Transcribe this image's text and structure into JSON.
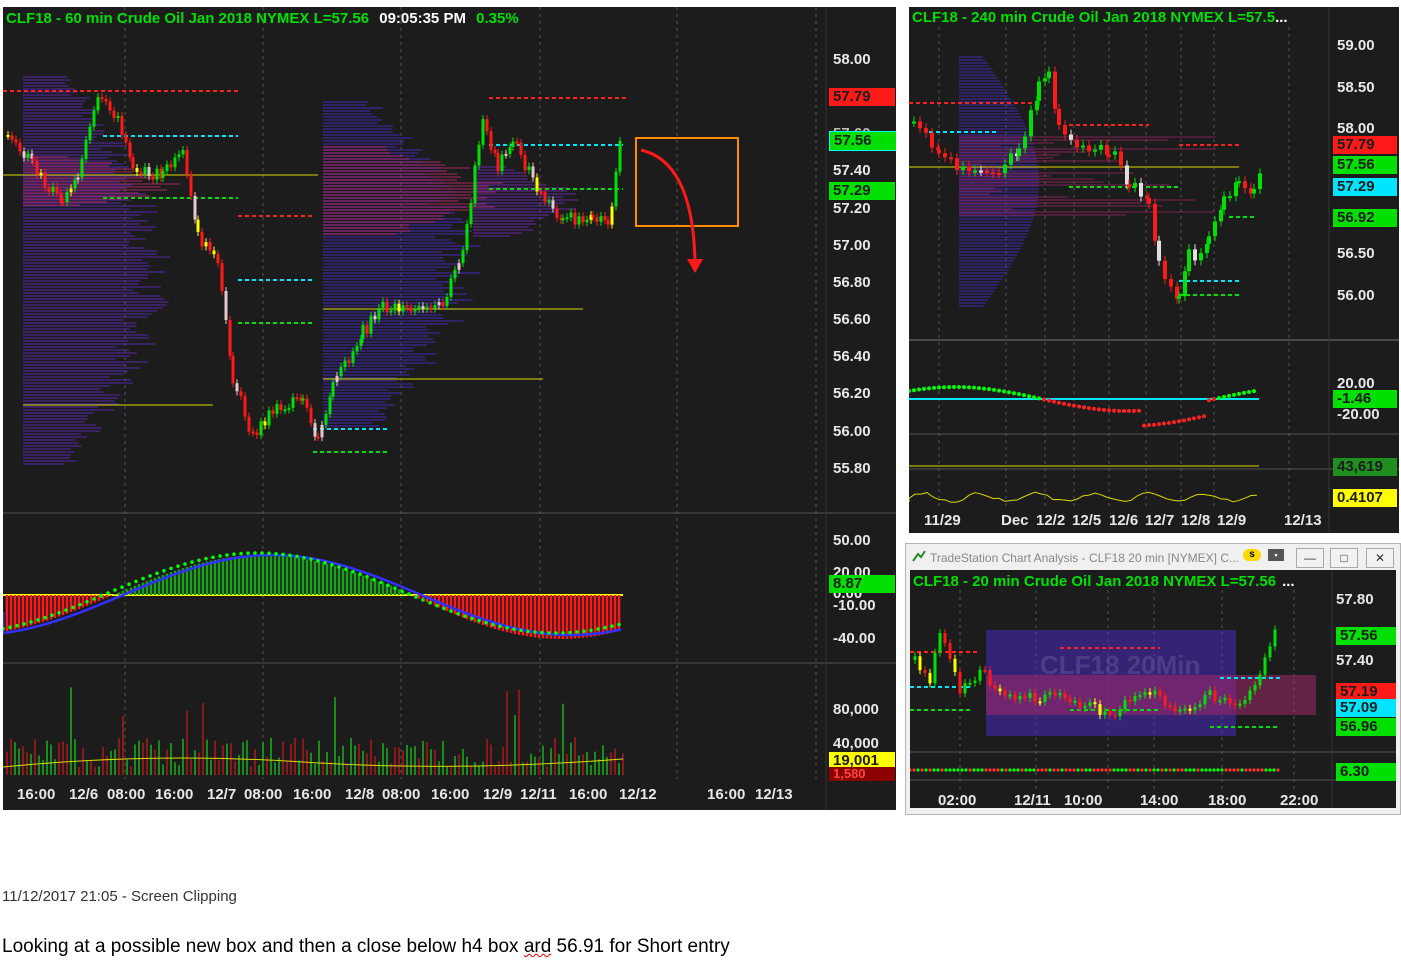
{
  "colors": {
    "bg": "#1c1c1c",
    "green": "#00e000",
    "red": "#ff1a1a",
    "cyan": "#00e5ff",
    "yellow": "#ffff00",
    "grid": "#444444",
    "orange": "#ff8c00"
  },
  "main_chart": {
    "title_parts": [
      "CLF18 - 60 min  Crude Oil Jan 2018  NYMEX  L=57.56",
      "09:05:35 PM",
      "0.35%"
    ],
    "price_axis": [
      "58.00",
      "57.60",
      "57.40",
      "57.20",
      "57.00",
      "56.80",
      "56.60",
      "56.40",
      "56.20",
      "56.00",
      "55.80"
    ],
    "price_badges": [
      {
        "text": "57.79",
        "color": "red"
      },
      {
        "text": "57.56",
        "color": "green"
      },
      {
        "text": "57.29",
        "color": "green"
      }
    ],
    "osc_axis": [
      "50.00",
      "20.00",
      "0.00",
      "-10.00",
      "-40.00"
    ],
    "osc_badge": "8.87",
    "vol_axis": [
      "80,000",
      "40,000"
    ],
    "vol_badges": [
      "19,001",
      "1,580"
    ],
    "time_axis": [
      "16:00",
      "12/6",
      "08:00",
      "16:00",
      "12/7",
      "08:00",
      "16:00",
      "12/8",
      "08:00",
      "16:00",
      "12/9",
      "12/11",
      "16:00",
      "12/12",
      "16:00",
      "12/13"
    ]
  },
  "h4_chart": {
    "title": "CLF18 - 240 min  Crude Oil Jan 2018  NYMEX  L=57.5",
    "title_more": "...",
    "price_axis": [
      "59.00",
      "58.50",
      "58.00",
      "56.50",
      "56.00"
    ],
    "price_badges": [
      {
        "text": "57.79",
        "color": "red"
      },
      {
        "text": "57.56",
        "color": "green"
      },
      {
        "text": "57.29",
        "color": "cyan"
      },
      {
        "text": "56.92",
        "color": "green"
      }
    ],
    "osc_axis": [
      "20.00",
      "-20.00"
    ],
    "osc_badge": "-1.46",
    "vol_badge": "43,619",
    "extra_badge": "0.4107",
    "time_axis": [
      "11/29",
      "Dec",
      "12/2",
      "12/5",
      "12/6",
      "12/7",
      "12/8",
      "12/9",
      "12/13"
    ]
  },
  "m20_window": {
    "window_title": "TradeStation Chart Analysis - CLF18 20 min [NYMEX] C...",
    "window_buttons": [
      "—",
      "□",
      "✕"
    ],
    "title": "CLF18 - 20 min  Crude Oil Jan 2018  NYMEX  L=57.56",
    "title_more": "...",
    "watermark": "CLF18 20Min",
    "price_axis": [
      "57.80",
      "57.40"
    ],
    "price_badges": [
      {
        "text": "57.56",
        "color": "green"
      },
      {
        "text": "57.19",
        "color": "red"
      },
      {
        "text": "57.09",
        "color": "cyan"
      },
      {
        "text": "56.96",
        "color": "green"
      }
    ],
    "osc_badge": "6.30",
    "time_axis": [
      "02:00",
      "12/11",
      "10:00",
      "14:00",
      "18:00",
      "22:00"
    ]
  },
  "notes": {
    "clip_meta": "11/12/2017 21:05 - Screen Clipping",
    "text_before": "Looking at a possible new box and then a close below h4 box ",
    "text_squiggle": "ard",
    "text_after": " 56.91 for Short entry"
  }
}
